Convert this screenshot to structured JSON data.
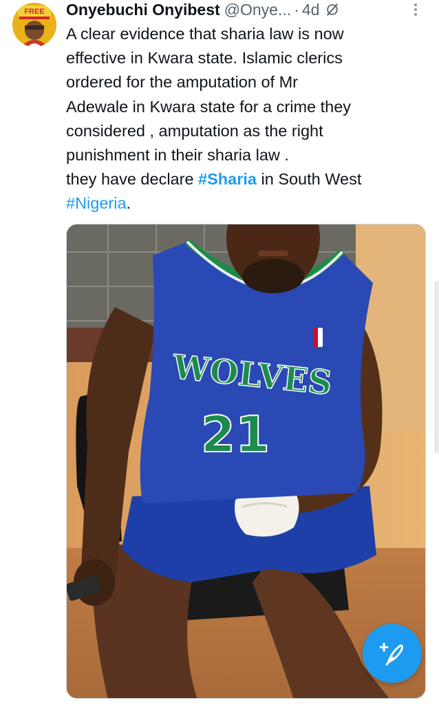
{
  "post": {
    "author_name": "Onyebuchi Onyibest",
    "author_handle": "@Onye...",
    "separator": "·",
    "time": "4d",
    "text_lines": [
      "A clear evidence that sharia law is now",
      "effective in Kwara state. Islamic clerics",
      "ordered for the  amputation of Mr",
      "Adewale  in Kwara state for a crime they",
      "considered , amputation as the right",
      "punishment in  their sharia law .",
      "they have declare "
    ],
    "hashtag_sharia": "#Sharia",
    "after_sharia": " in South West",
    "hashtag_nigeria": "#Nigeria",
    "end_text": ".",
    "avatar_badge": "FREE",
    "jersey_team": "WOLVES",
    "jersey_number": "21"
  },
  "icons": {
    "grok": "grok-icon",
    "more": "more-vertical-icon",
    "compose": "compose-post-icon"
  },
  "colors": {
    "link": "#1d9bf0",
    "text": "#0f1419",
    "muted": "#536471",
    "fab": "#1d9bf0"
  }
}
